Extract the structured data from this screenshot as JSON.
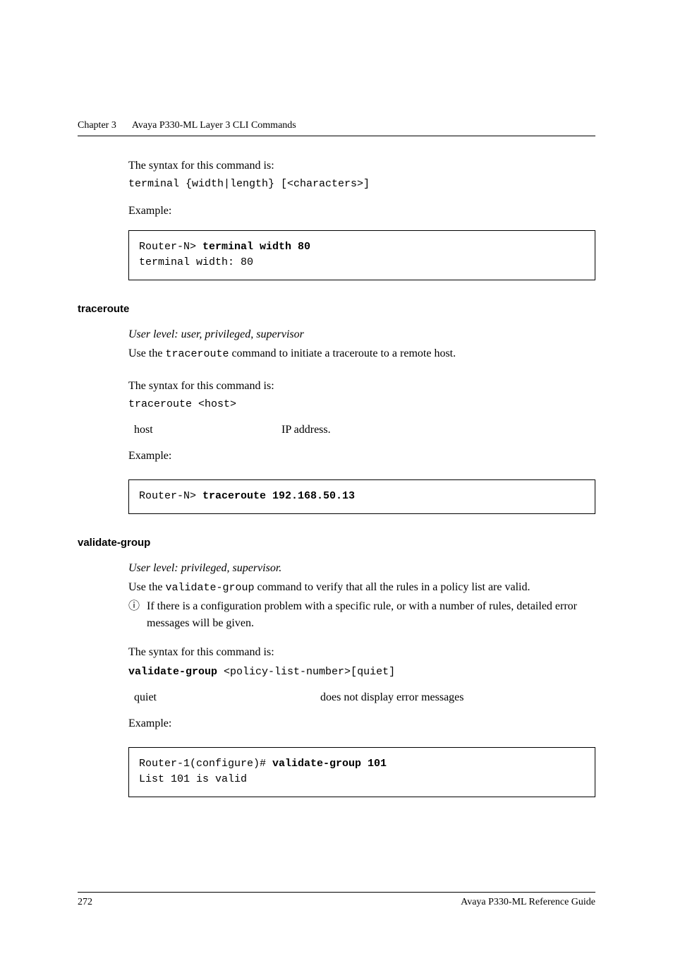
{
  "header": {
    "chapter": "Chapter 3",
    "title": "Avaya P330-ML Layer 3 CLI Commands"
  },
  "intro": {
    "syntax_label": "The syntax for this command is:",
    "syntax_code": "terminal {width|length} [<characters>]",
    "example_label": "Example:",
    "code_line1_prompt": "Router-N> ",
    "code_line1_cmd": "terminal width 80",
    "code_line2": "terminal width: 80"
  },
  "traceroute": {
    "heading": "traceroute",
    "user_level": "User level: user, privileged, supervisor",
    "desc_pre": "Use the ",
    "desc_cmd": "traceroute",
    "desc_post": " command to initiate a traceroute to a remote host.",
    "syntax_label": "The syntax for this command is:",
    "syntax_code": "traceroute <host>",
    "param_name": "host",
    "param_desc": "IP address.",
    "example_label": "Example:",
    "code_prompt": "Router-N> ",
    "code_cmd": "traceroute 192.168.50.13"
  },
  "validate": {
    "heading": "validate-group",
    "user_level": "User level: privileged, supervisor.",
    "desc_pre": "Use the ",
    "desc_cmd": "validate-group",
    "desc_post": " command to verify that all the rules in a policy list are valid.",
    "info_icon": "ⓘ",
    "info_text": "If there is a configuration problem with a specific rule, or with a number of rules, detailed error messages will be given.",
    "syntax_label": "The syntax for this command is:",
    "syntax_bold": "validate-group",
    "syntax_rest": " <policy-list-number>[quiet]",
    "param_name": "quiet",
    "param_desc": "does not display error messages",
    "example_label": "Example:",
    "code_line1_prompt": "Router-1(configure)# ",
    "code_line1_cmd": "validate-group 101",
    "code_line2": "List 101 is valid"
  },
  "footer": {
    "page": "272",
    "right": "Avaya P330-ML Reference Guide"
  }
}
